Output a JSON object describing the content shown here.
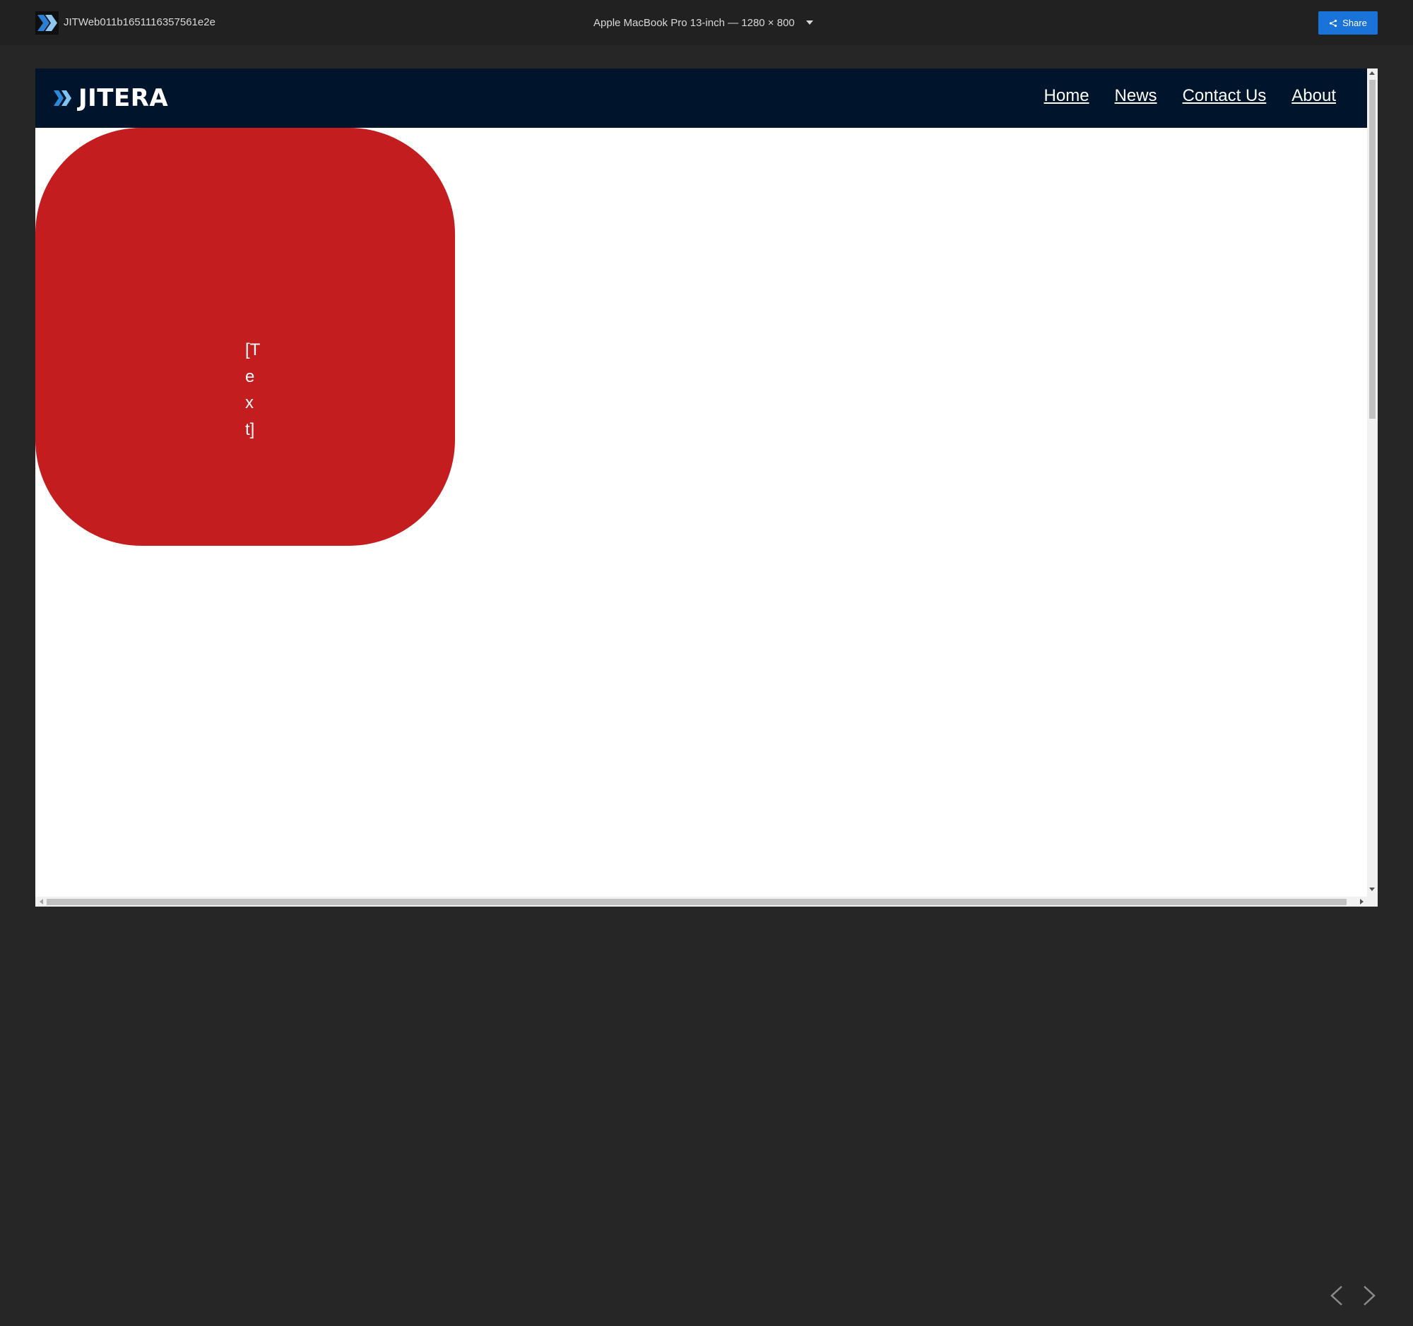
{
  "toolbar": {
    "project_name": "JITWeb011b1651116357561e2e",
    "device_label": "Apple MacBook Pro 13-inch — 1280 × 800",
    "share_label": "Share",
    "accent_color": "#1a73d9"
  },
  "site": {
    "logo_text": "JITERA",
    "nav": [
      {
        "label": "Home"
      },
      {
        "label": "News"
      },
      {
        "label": "Contact Us"
      },
      {
        "label": "About"
      }
    ],
    "header_color": "#00152b",
    "card": {
      "text": "[Text]",
      "color": "#c31d1f"
    }
  },
  "icons": {
    "app_logo": "jitera-chevrons-icon",
    "device_dropdown": "caret-down-icon",
    "share": "share-icon",
    "prev": "chevron-left-icon",
    "next": "chevron-right-icon"
  }
}
